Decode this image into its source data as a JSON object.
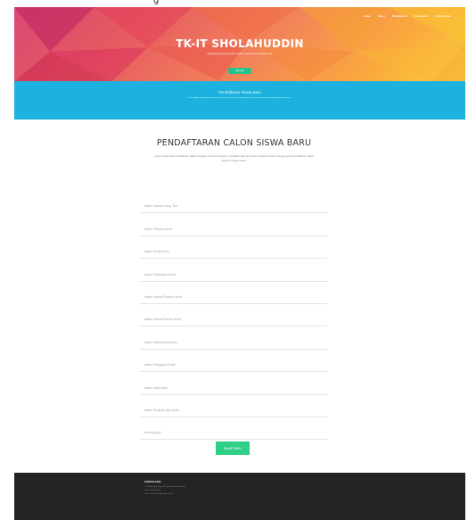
{
  "top": {
    "text": "g"
  },
  "nav": {
    "items": [
      "Home",
      "About",
      "Pendaftaran",
      "Testimonial",
      "Kontak Kami"
    ]
  },
  "hero": {
    "brand": "TK-IT SHOLAHUDDIN",
    "tagline": "Membentuk generasi Qurani, cerdas, mandiri dan berakhlak mulia",
    "button": "DAFTAR"
  },
  "band": {
    "title": "Pendaftaran Siswa Baru",
    "desc": "Telah dibuka pendaftaran siswa baru tahun ajaran ini. Segera daftarkan putra putri anda dan bergabung bersama kami."
  },
  "form": {
    "title": "PENDAFTARAN CALON SISWA BARU",
    "desc": "Untuk mengirimkan pendaftaran, silakan lengkapi formulir di bawah ini. Pastikan data yang anda masukkan benar sehingga proses pendaftaran dapat berjalan dengan lancar.",
    "fields": [
      "Isikan Nama Orang Tua",
      "Isikan Telepon Anda",
      "Isikan Email Anda",
      "Isikan Pekerjaan Anda",
      "Isikan Alamat Rumah Anda",
      "Isikan Alamat Kantor Anda",
      "Isikan Nama Anak Anda",
      "Isikan Panggilan Anak",
      "Isikan Usia Anak",
      "Isikan Tempat Lahir Anak",
      "mm/dd/yyyy"
    ],
    "submit": "DAFTAR"
  },
  "footer": {
    "title": "KONTAK KAMI",
    "lines": [
      "Jl. Sholahuddin Raya, Kecamatan Kota, Indonesia",
      "Telp: (021) 0000000",
      "Email: info@tkitsholahuddin.sch.id"
    ]
  }
}
